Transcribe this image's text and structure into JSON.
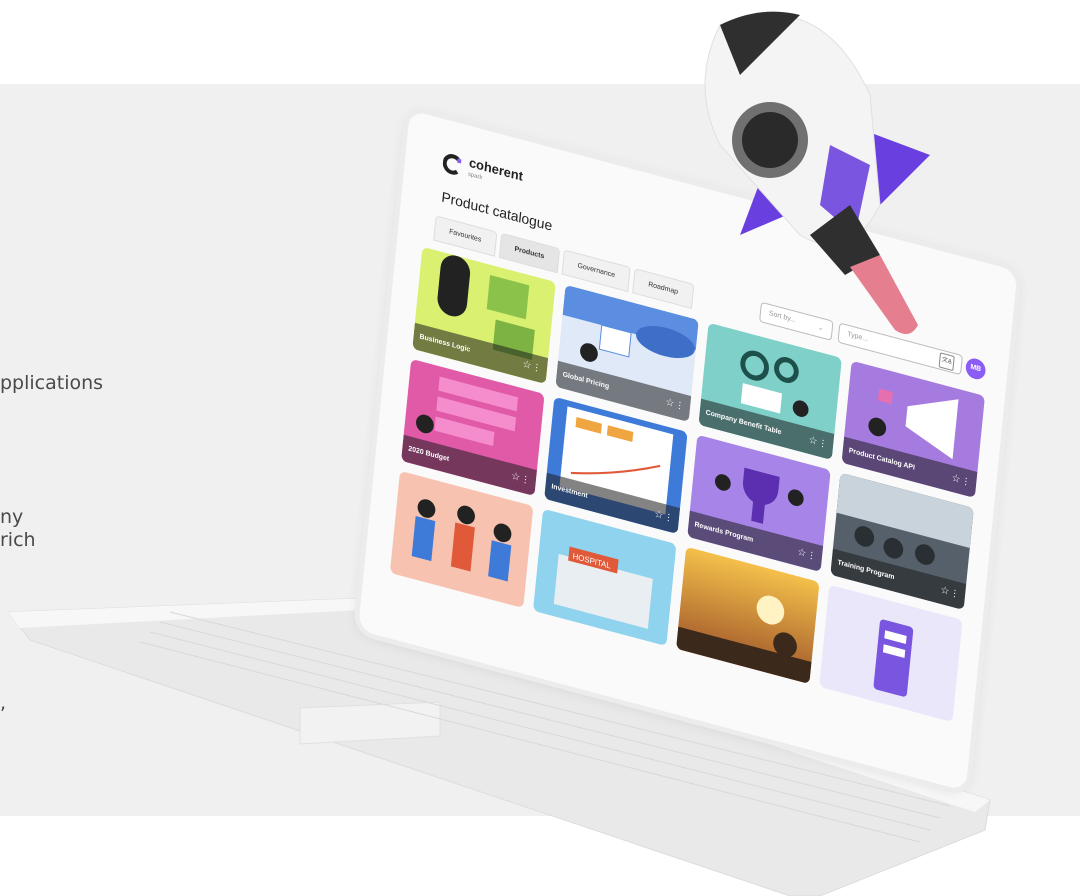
{
  "left_fragments": [
    "pplications",
    "ny",
    "rich",
    ","
  ],
  "app": {
    "logo_name": "coherent",
    "logo_sub": "spark",
    "page_title": "Product catalogue",
    "tabs": [
      {
        "label": "Favourites",
        "active": false
      },
      {
        "label": "Products",
        "active": true
      },
      {
        "label": "Governance",
        "active": false
      },
      {
        "label": "Roadmap",
        "active": false
      }
    ],
    "sort_placeholder": "Sort by...",
    "type_placeholder": "Type...",
    "avatar_initials": "MB",
    "cards": [
      {
        "label": "Business Logic",
        "bg": "#d9f070"
      },
      {
        "label": "Global Pricing",
        "bg": "#5b8ee0"
      },
      {
        "label": "Company Benefit Table",
        "bg": "#7fd0c9"
      },
      {
        "label": "Product Catalog API",
        "bg": "#a67be0"
      },
      {
        "label": "2020 Budget",
        "bg": "#e05aa8"
      },
      {
        "label": "Investment",
        "bg": "#3e7bd8"
      },
      {
        "label": "Rewards Program",
        "bg": "#a784e8"
      },
      {
        "label": "Training Program",
        "bg": "#55606a"
      },
      {
        "label": "",
        "bg": "#f7c2b0"
      },
      {
        "label": "",
        "bg": "#8fd3ee"
      },
      {
        "label": "",
        "bg": "#e59a36"
      },
      {
        "label": "",
        "bg": "#eae7fb"
      }
    ]
  },
  "colors": {
    "accent": "#8b5cf6",
    "background": "#f0f0f0"
  }
}
